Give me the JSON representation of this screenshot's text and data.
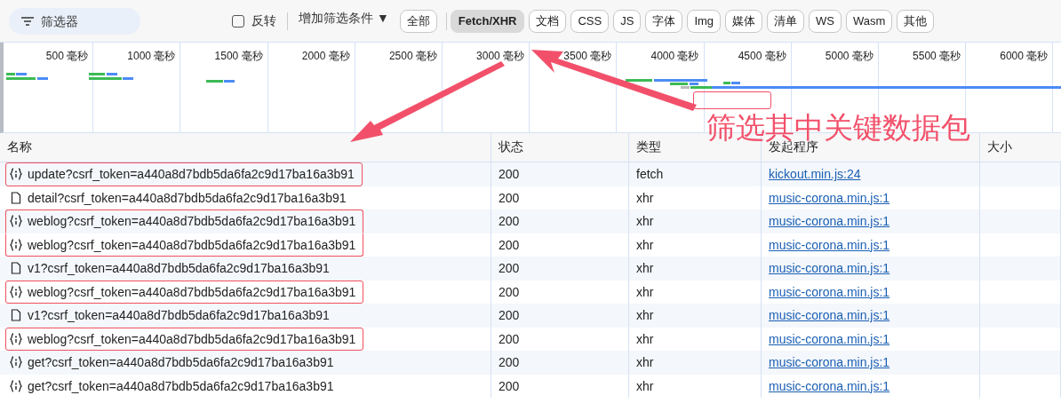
{
  "toolbar": {
    "filter": {
      "placeholder": "筛选器"
    },
    "invert": {
      "label": "反转",
      "checked": false
    },
    "more_filters": {
      "label": "增加筛选条件 ▼"
    },
    "types": [
      {
        "label": "全部",
        "selected": false
      },
      {
        "label": "Fetch/XHR",
        "selected": true
      },
      {
        "label": "文档",
        "selected": false
      },
      {
        "label": "CSS",
        "selected": false
      },
      {
        "label": "JS",
        "selected": false
      },
      {
        "label": "字体",
        "selected": false
      },
      {
        "label": "Img",
        "selected": false
      },
      {
        "label": "媒体",
        "selected": false
      },
      {
        "label": "清单",
        "selected": false
      },
      {
        "label": "WS",
        "selected": false
      },
      {
        "label": "Wasm",
        "selected": false
      },
      {
        "label": "其他",
        "selected": false
      }
    ]
  },
  "overview": {
    "ticks": [
      "500 毫秒",
      "1000 毫秒",
      "1500 毫秒",
      "2000 毫秒",
      "2500 毫秒",
      "3000 毫秒",
      "3500 毫秒",
      "4000 毫秒",
      "4500 毫秒",
      "5000 毫秒",
      "5500 毫秒",
      "6000 毫秒"
    ]
  },
  "annotation": {
    "text": "筛选其中关键数据包"
  },
  "table": {
    "columns": [
      "名称",
      "状态",
      "类型",
      "发起程序",
      "大小"
    ],
    "rows": [
      {
        "kind": "fetch",
        "name": "update?csrf_token=a440a8d7bdb5da6fa2c9d17ba16a3b91",
        "status": "200",
        "type": "fetch",
        "initiator": "kickout.min.js:24",
        "highlighted": true
      },
      {
        "kind": "document",
        "name": "detail?csrf_token=a440a8d7bdb5da6fa2c9d17ba16a3b91",
        "status": "200",
        "type": "xhr",
        "initiator": "music-corona.min.js:1",
        "highlighted": false
      },
      {
        "kind": "fetch",
        "name": "weblog?csrf_token=a440a8d7bdb5da6fa2c9d17ba16a3b91",
        "status": "200",
        "type": "xhr",
        "initiator": "music-corona.min.js:1",
        "highlighted": true
      },
      {
        "kind": "fetch",
        "name": "weblog?csrf_token=a440a8d7bdb5da6fa2c9d17ba16a3b91",
        "status": "200",
        "type": "xhr",
        "initiator": "music-corona.min.js:1",
        "highlighted": true
      },
      {
        "kind": "document",
        "name": "v1?csrf_token=a440a8d7bdb5da6fa2c9d17ba16a3b91",
        "status": "200",
        "type": "xhr",
        "initiator": "music-corona.min.js:1",
        "highlighted": false
      },
      {
        "kind": "fetch",
        "name": "weblog?csrf_token=a440a8d7bdb5da6fa2c9d17ba16a3b91",
        "status": "200",
        "type": "xhr",
        "initiator": "music-corona.min.js:1",
        "highlighted": true
      },
      {
        "kind": "document",
        "name": "v1?csrf_token=a440a8d7bdb5da6fa2c9d17ba16a3b91",
        "status": "200",
        "type": "xhr",
        "initiator": "music-corona.min.js:1",
        "highlighted": false
      },
      {
        "kind": "fetch",
        "name": "weblog?csrf_token=a440a8d7bdb5da6fa2c9d17ba16a3b91",
        "status": "200",
        "type": "xhr",
        "initiator": "music-corona.min.js:1",
        "highlighted": true
      },
      {
        "kind": "fetch",
        "name": "get?csrf_token=a440a8d7bdb5da6fa2c9d17ba16a3b91",
        "status": "200",
        "type": "xhr",
        "initiator": "music-corona.min.js:1",
        "highlighted": false
      },
      {
        "kind": "fetch",
        "name": "get?csrf_token=a440a8d7bdb5da6fa2c9d17ba16a3b91",
        "status": "200",
        "type": "xhr",
        "initiator": "music-corona.min.js:1",
        "highlighted": false
      }
    ]
  }
}
